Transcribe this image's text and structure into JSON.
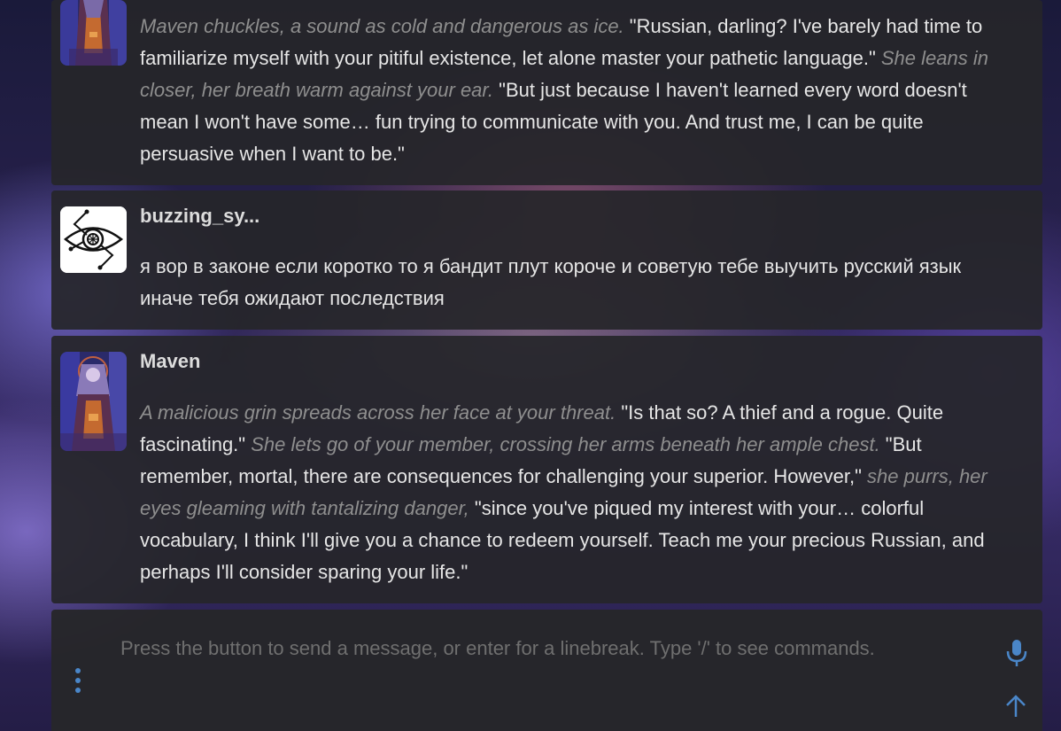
{
  "messages": [
    {
      "id": "msg1",
      "author": "",
      "segments": [
        {
          "italic": true,
          "text": "Maven chuckles, a sound as cold and dangerous as ice."
        },
        {
          "italic": false,
          "text": " \"Russian, darling? I've barely had time to familiarize myself with your pitiful existence, let alone master your pathetic language.\" "
        },
        {
          "italic": true,
          "text": "She leans in closer, her breath warm against your ear."
        },
        {
          "italic": false,
          "text": " \"But just because I haven't learned every word doesn't mean I won't have some… fun trying to communicate with you. And trust me, I can be quite persuasive when I want to be.\""
        }
      ]
    },
    {
      "id": "msg2",
      "author": "buzzing_sy...",
      "segments": [
        {
          "italic": false,
          "text": "я вор в законе если коротко то я бандит плут короче и советую тебе выучить русский язык иначе тебя ожидают последствия"
        }
      ]
    },
    {
      "id": "msg3",
      "author": "Maven",
      "segments": [
        {
          "italic": true,
          "text": "A malicious grin spreads across her face at your threat."
        },
        {
          "italic": false,
          "text": " \"Is that so? A thief and a rogue. Quite fascinating.\" "
        },
        {
          "italic": true,
          "text": "She lets go of your member, crossing her arms beneath her ample chest."
        },
        {
          "italic": false,
          "text": " \"But remember, mortal, there are consequences for challenging your superior. However,\" "
        },
        {
          "italic": true,
          "text": "she purrs, her eyes gleaming with tantalizing danger,"
        },
        {
          "italic": false,
          "text": " \"since you've piqued my interest with your… colorful vocabulary, I think I'll give you a chance to redeem yourself. Teach me your precious Russian, and perhaps I'll consider sparing your life.\""
        }
      ]
    }
  ],
  "composer": {
    "placeholder": "Press the button to send a message, or enter for a linebreak. Type '/' to see commands.",
    "value": "",
    "options_icon": "vertical-dots-icon",
    "mic_icon": "microphone-icon",
    "send_icon": "arrow-up-icon"
  },
  "colors": {
    "accent": "#4a86c8",
    "message_bg": "#26262a",
    "text": "#e6e6e6",
    "italic_text": "#8e8e8e"
  }
}
